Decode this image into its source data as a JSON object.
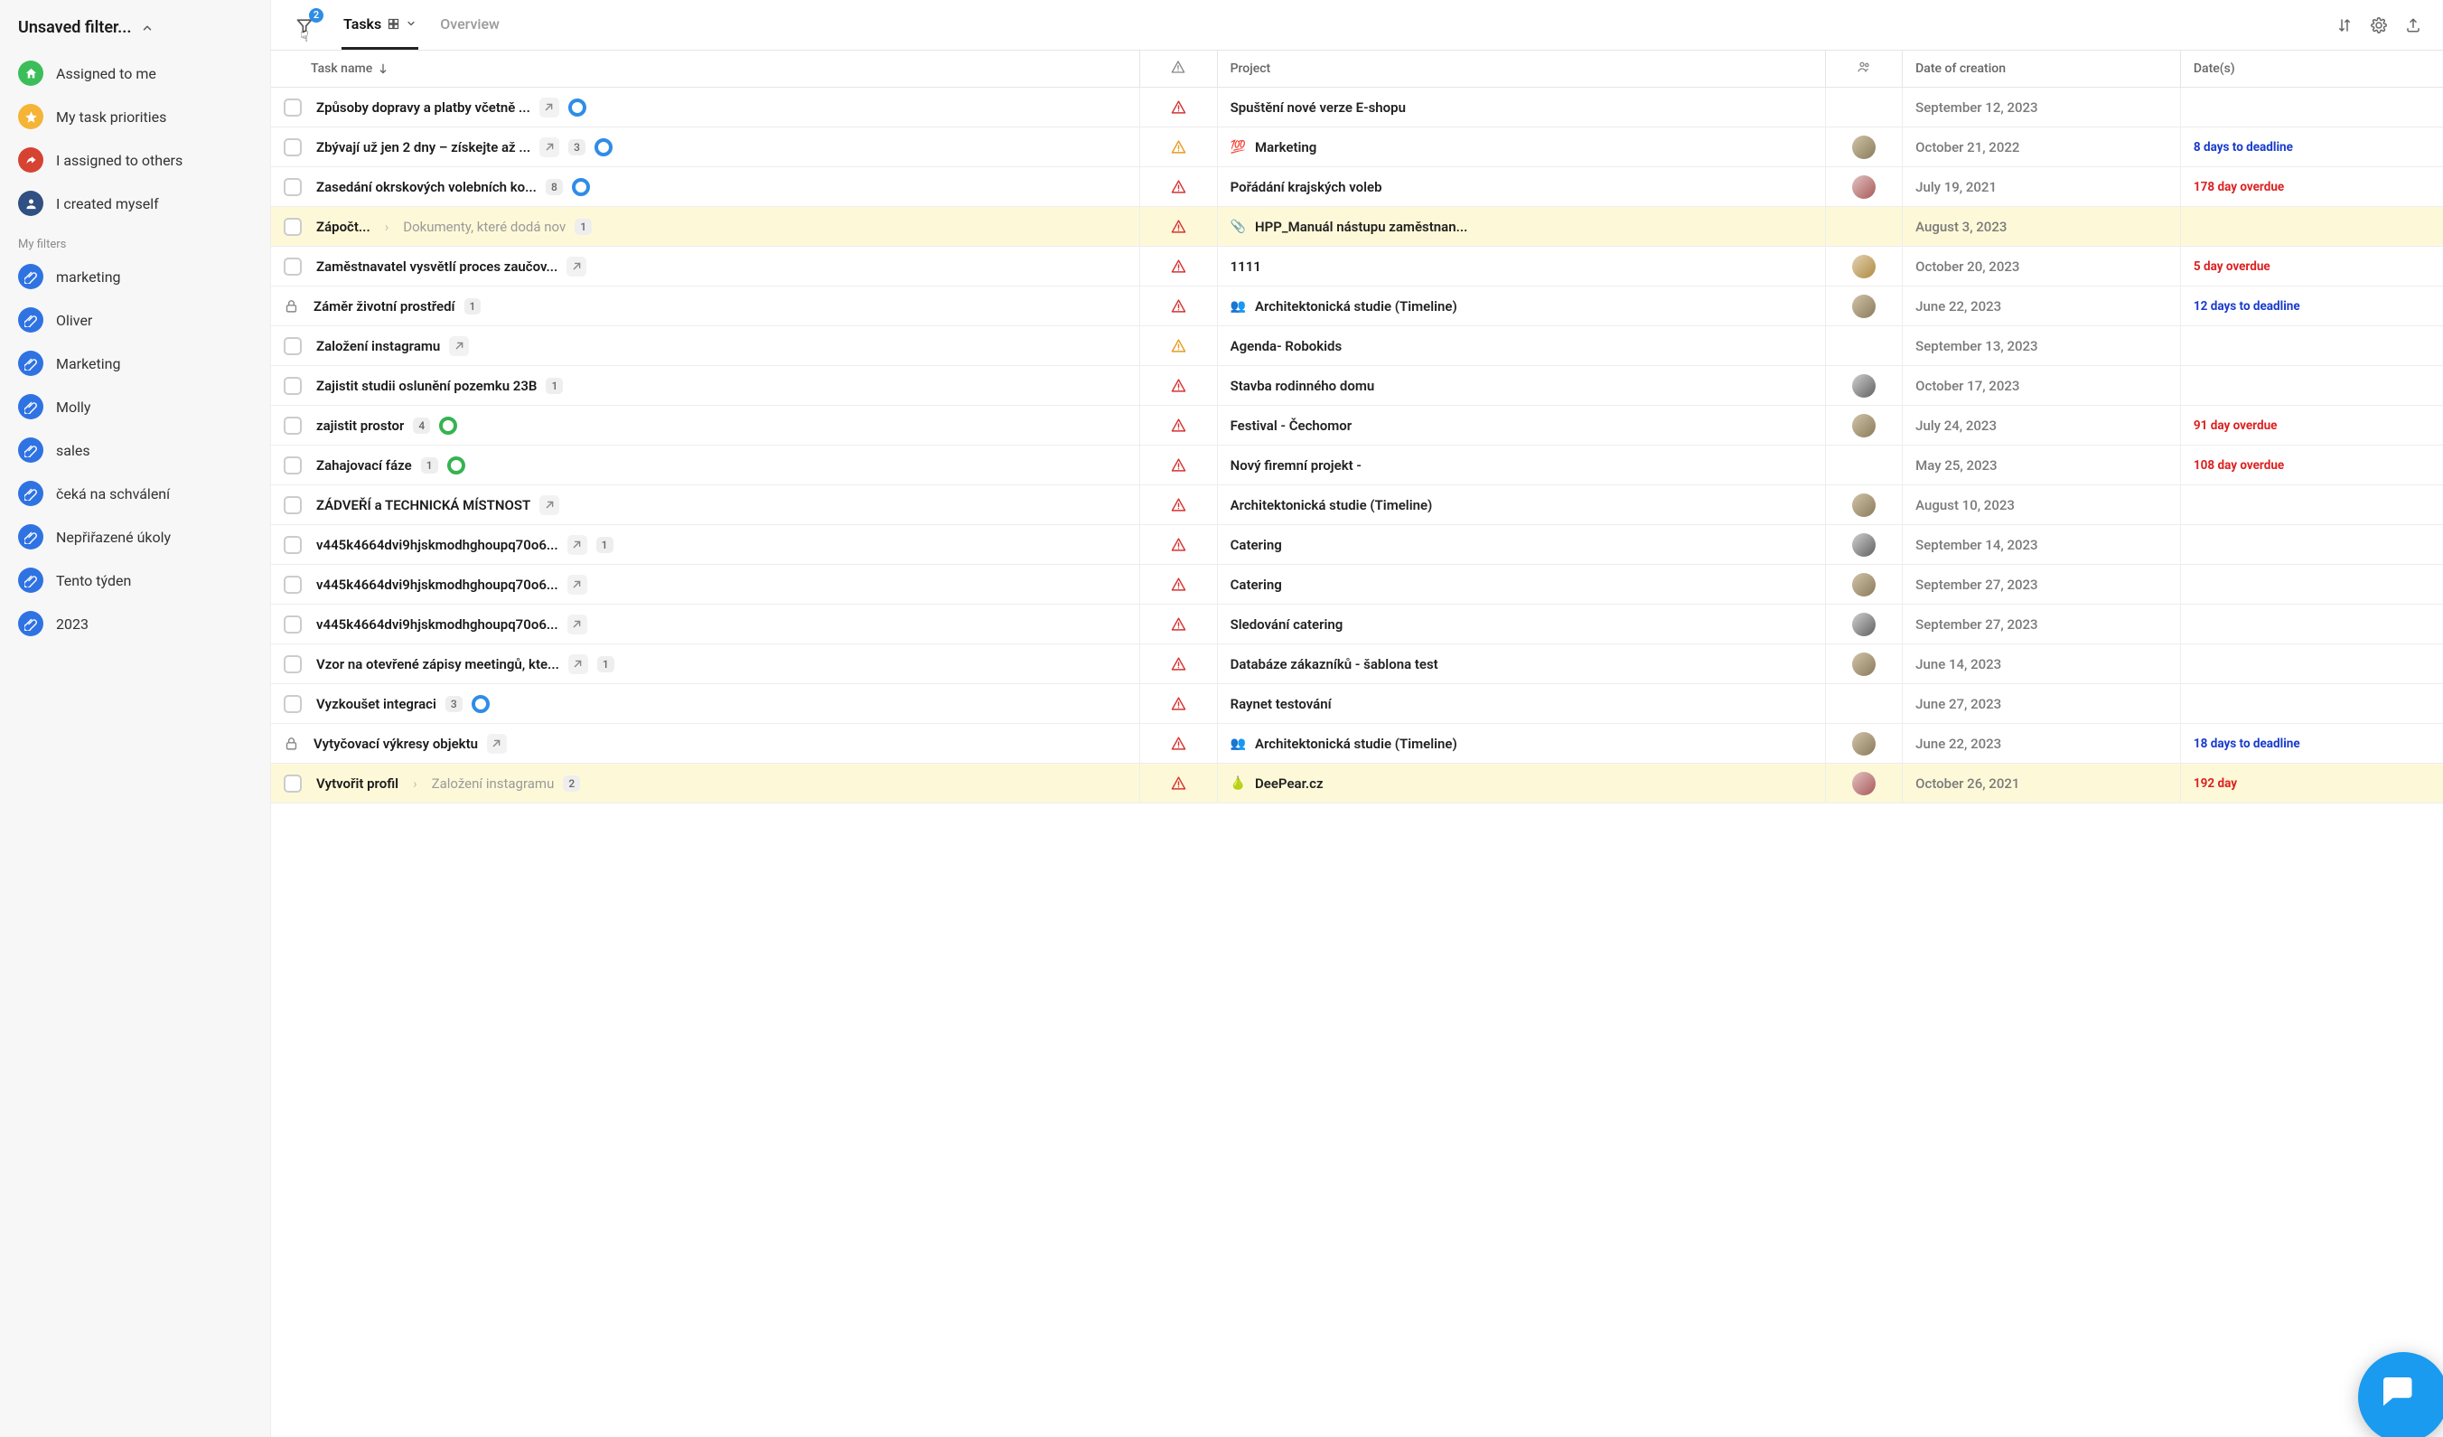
{
  "sidebar": {
    "title": "Unsaved filter...",
    "primaryItems": [
      {
        "label": "Assigned to me",
        "icon": "home"
      },
      {
        "label": "My task priorities",
        "icon": "star"
      },
      {
        "label": "I assigned to others",
        "icon": "share"
      },
      {
        "label": "I created myself",
        "icon": "user"
      }
    ],
    "filtersLabel": "My filters",
    "filterItems": [
      "marketing",
      "Oliver",
      "Marketing",
      "Molly",
      "sales",
      "čeká na schválení",
      "Nepřiřazené úkoly",
      "Tento týden",
      "2023"
    ]
  },
  "toolbar": {
    "filterCount": "2",
    "tab_tasks": "Tasks",
    "tab_overview": "Overview"
  },
  "columns": {
    "taskName": "Task name",
    "project": "Project",
    "dateCreated": "Date of creation",
    "dates": "Date(s)"
  },
  "rows": [
    {
      "name": "Způsoby dopravy a platby včetně ...",
      "link": true,
      "ring": "blue",
      "priority": "red",
      "project": "Spuštění nové verze E-shopu",
      "assignee": "",
      "date": "September 12, 2023",
      "due": "",
      "dueClass": ""
    },
    {
      "name": "Zbývají už jen 2 dny – získejte až ...",
      "link": true,
      "badge": "3",
      "ring": "blue",
      "priority": "orange",
      "projectEmoji": "💯",
      "project": "Marketing",
      "assignee": "v1",
      "date": "October 21, 2022",
      "due": "8 days to deadline",
      "dueClass": "blue"
    },
    {
      "name": "Zasedání okrskových volebních ko...",
      "badge": "8",
      "ring": "blue",
      "priority": "red",
      "project": "Pořádání krajských voleb",
      "assignee": "v3",
      "date": "July 19, 2021",
      "due": "178 day overdue",
      "dueClass": "red"
    },
    {
      "name": "Zápočt...",
      "path": "Dokumenty, které dodá nov",
      "badge": "1",
      "priority": "red",
      "projectEmoji": "📎",
      "project": "HPP_Manuál nástupu zaměstnan...",
      "assignee": "",
      "date": "August 3, 2023",
      "due": "",
      "dueClass": "",
      "highlight": true
    },
    {
      "name": "Zaměstnavatel vysvětlí proces zaučov...",
      "link": true,
      "priority": "red",
      "project": "1111",
      "assignee": "v5",
      "date": "October 20, 2023",
      "due": "5 day overdue",
      "dueClass": "red"
    },
    {
      "name": "Záměr životní prostředí",
      "lock": true,
      "badge": "1",
      "priority": "red",
      "projectEmoji": "👥",
      "project": "Architektonická studie (Timeline)",
      "assignee": "v1",
      "date": "June 22, 2023",
      "due": "12 days to deadline",
      "dueClass": "blue"
    },
    {
      "name": "Založení instagramu",
      "link": true,
      "priority": "orange",
      "project": "Agenda- Robokids",
      "assignee": "",
      "date": "September 13, 2023",
      "due": "",
      "dueClass": ""
    },
    {
      "name": "Zajistit studii oslunění pozemku 23B",
      "badge": "1",
      "priority": "red",
      "project": "Stavba rodinného domu",
      "assignee": "v4",
      "date": "October 17, 2023",
      "due": "",
      "dueClass": ""
    },
    {
      "name": "zajistit prostor",
      "badge": "4",
      "ring": "green",
      "priority": "red",
      "project": "Festival - Čechomor",
      "assignee": "v1",
      "date": "July 24, 2023",
      "due": "91 day overdue",
      "dueClass": "red"
    },
    {
      "name": "Zahajovací fáze",
      "badge": "1",
      "ring": "green",
      "priority": "red",
      "project": "Nový firemní projekt -",
      "assignee": "",
      "date": "May 25, 2023",
      "due": "108 day overdue",
      "dueClass": "red"
    },
    {
      "name": "ZÁDVEŘÍ a TECHNICKÁ MÍSTNOST",
      "link": true,
      "priority": "red",
      "project": "Architektonická studie (Timeline)",
      "assignee": "v1",
      "date": "August 10, 2023",
      "due": "",
      "dueClass": ""
    },
    {
      "name": "v445k4664dvi9hjskmodhghoupq70o6...",
      "link": true,
      "badge": "1",
      "priority": "red",
      "project": "Catering",
      "assignee": "v4",
      "date": "September 14, 2023",
      "due": "",
      "dueClass": ""
    },
    {
      "name": "v445k4664dvi9hjskmodhghoupq70o6...",
      "link": true,
      "priority": "red",
      "project": "Catering",
      "assignee": "v1",
      "date": "September 27, 2023",
      "due": "",
      "dueClass": ""
    },
    {
      "name": "v445k4664dvi9hjskmodhghoupq70o6...",
      "link": true,
      "priority": "red",
      "project": "Sledování catering",
      "assignee": "v4",
      "date": "September 27, 2023",
      "due": "",
      "dueClass": ""
    },
    {
      "name": "Vzor na otevřené zápisy meetingů, kte...",
      "link": true,
      "badge": "1",
      "priority": "red",
      "project": "Databáze zákazníků - šablona test",
      "assignee": "v1",
      "date": "June 14, 2023",
      "due": "",
      "dueClass": ""
    },
    {
      "name": "Vyzkoušet integraci",
      "badge": "3",
      "ring": "blue",
      "priority": "red",
      "project": "Raynet testování",
      "assignee": "",
      "date": "June 27, 2023",
      "due": "",
      "dueClass": ""
    },
    {
      "name": "Vytyčovací výkresy objektu",
      "lock": true,
      "link": true,
      "priority": "red",
      "projectEmoji": "👥",
      "project": "Architektonická studie (Timeline)",
      "assignee": "v1",
      "date": "June 22, 2023",
      "due": "18 days to deadline",
      "dueClass": "blue"
    },
    {
      "name": "Vytvořit profil",
      "path": "Založení instagramu",
      "badge": "2",
      "priority": "red",
      "projectEmoji": "🍐",
      "project": "DeePear.cz",
      "assignee": "v3",
      "date": "October 26, 2021",
      "due": "192 day",
      "dueClass": "red",
      "highlight": true
    }
  ]
}
